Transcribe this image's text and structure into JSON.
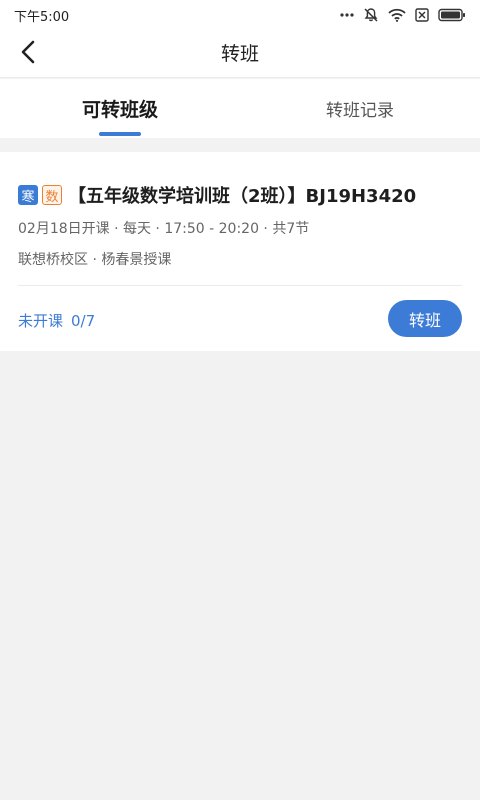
{
  "status_bar": {
    "time": "下午5:00",
    "icons": [
      "more-dots-icon",
      "mute-icon",
      "wifi-icon",
      "sim-off-icon",
      "battery-icon"
    ]
  },
  "nav": {
    "title": "转班",
    "back_icon": "chevron-left-icon"
  },
  "tabs": [
    {
      "label": "可转班级",
      "active": true
    },
    {
      "label": "转班记录",
      "active": false
    }
  ],
  "course": {
    "tags": [
      "寒",
      "数"
    ],
    "title": "【五年级数学培训班（2班）】BJ19H3420",
    "schedule": "02月18日开课 · 每天 · 17:50 - 20:20 · 共7节",
    "location": "联想桥校区 · 杨春景授课",
    "status": "未开课",
    "enrollment": "0/7",
    "action_label": "转班"
  },
  "colors": {
    "accent": "#3c7bd6",
    "winter_tag": "#3a7bd5",
    "subject_tag": "#e8823a",
    "background": "#f2f2f2"
  }
}
